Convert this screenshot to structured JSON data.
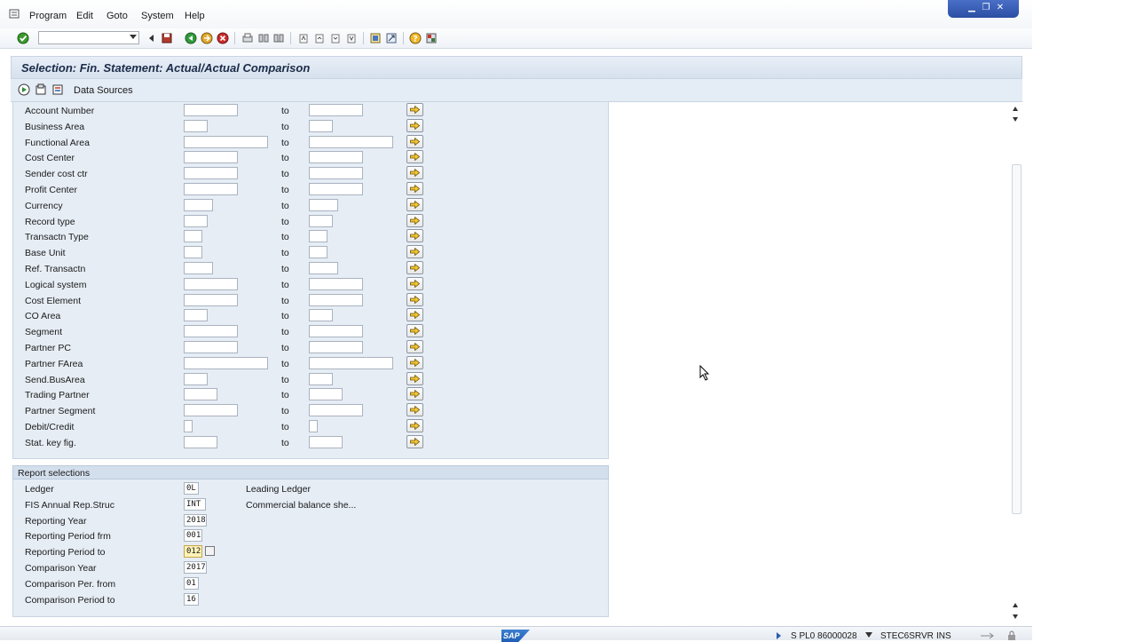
{
  "menu": [
    "Program",
    "Edit",
    "Goto",
    "System",
    "Help"
  ],
  "title": "Selection: Fin. Statement: Actual/Actual Comparison",
  "app_toolbar": {
    "data_sources_label": "Data Sources"
  },
  "range_to_label": "to",
  "selection_rows": [
    {
      "label": "Account Number"
    },
    {
      "label": "Business Area"
    },
    {
      "label": "Functional Area"
    },
    {
      "label": "Cost Center"
    },
    {
      "label": "Sender cost ctr"
    },
    {
      "label": "Profit Center"
    },
    {
      "label": "Currency"
    },
    {
      "label": "Record type"
    },
    {
      "label": "Transactn Type"
    },
    {
      "label": "Base Unit"
    },
    {
      "label": "Ref. Transactn"
    },
    {
      "label": "Logical system"
    },
    {
      "label": "Cost Element"
    },
    {
      "label": "CO Area"
    },
    {
      "label": "Segment"
    },
    {
      "label": "Partner PC"
    },
    {
      "label": "Partner FArea"
    },
    {
      "label": "Send.BusArea"
    },
    {
      "label": "Trading Partner"
    },
    {
      "label": "Partner Segment"
    },
    {
      "label": "Debit/Credit"
    },
    {
      "label": "Stat. key fig."
    }
  ],
  "report_selections": {
    "header": "Report selections",
    "rows": [
      {
        "label": "Ledger",
        "value": "0L",
        "desc": "Leading Ledger"
      },
      {
        "label": "FIS Annual Rep.Struc",
        "value": "INT",
        "desc": "Commercial balance she..."
      },
      {
        "label": "Reporting Year",
        "value": "2018",
        "desc": ""
      },
      {
        "label": "Reporting Period frm",
        "value": "001",
        "desc": ""
      },
      {
        "label": "Reporting Period to",
        "value": "012",
        "desc": ""
      },
      {
        "label": "Comparison Year",
        "value": "2017",
        "desc": ""
      },
      {
        "label": "Comparison Per. from",
        "value": "01",
        "desc": ""
      },
      {
        "label": "Comparison Period to",
        "value": "16",
        "desc": ""
      }
    ]
  },
  "status": {
    "logo": "SAP",
    "system": "S PL0 86000028",
    "server": "STEC6SRVR",
    "mode": "INS"
  }
}
